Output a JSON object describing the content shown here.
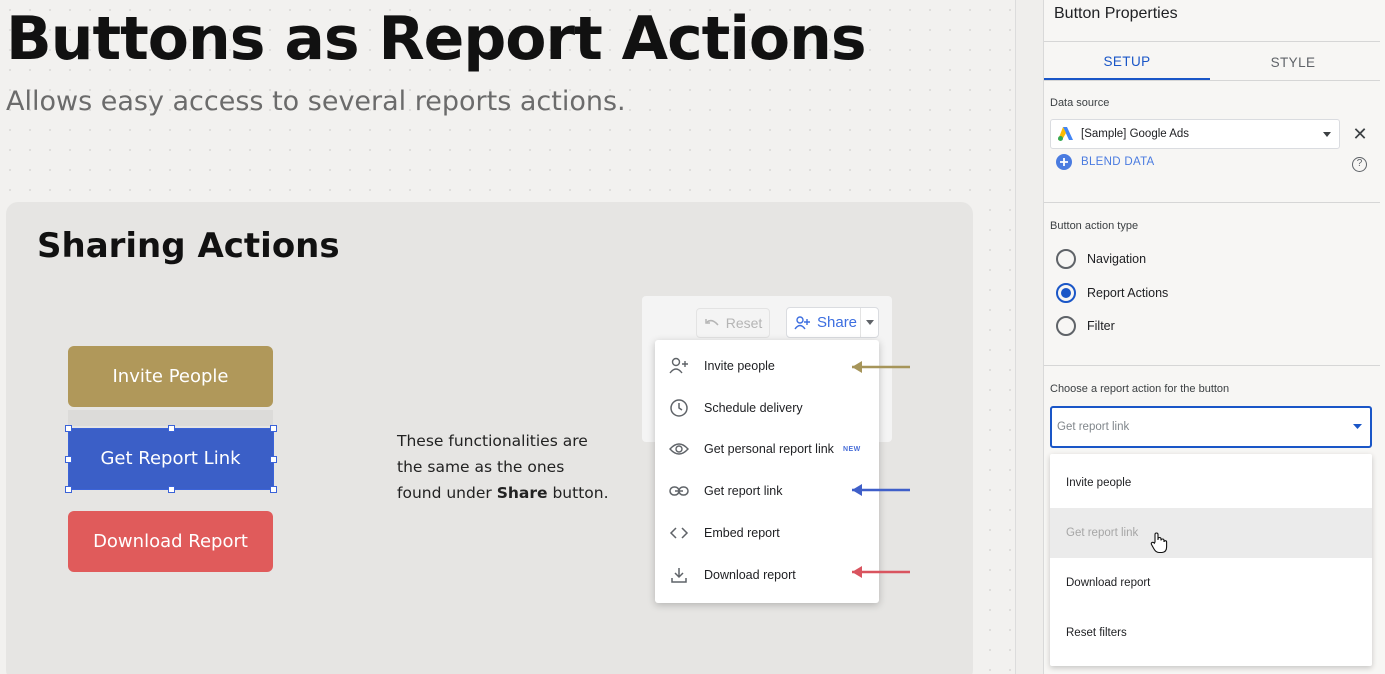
{
  "slide": {
    "title": "Buttons as Report Actions",
    "subtitle": "Allows easy access to several reports actions.",
    "card_title": "Sharing Actions",
    "buttons": {
      "invite": "Invite People",
      "get_link": "Get Report Link",
      "download": "Download Report"
    },
    "button_colors": {
      "invite": "#b0985a",
      "get_link": "#3b5fc7",
      "download": "#e05b5b"
    },
    "description": {
      "line1": "These functionalities are",
      "line2": "the same as the ones",
      "line3_prefix": "found under",
      "line3_bold": "Share",
      "line3_suffix": "button."
    }
  },
  "share_toolbar": {
    "reset_label": "Reset",
    "share_label": "Share",
    "menu_items": [
      {
        "label": "Invite people",
        "icon": "person-add-icon"
      },
      {
        "label": "Schedule delivery",
        "icon": "clock-icon"
      },
      {
        "label": "Get personal report link",
        "icon": "eye-icon",
        "badge": "NEW"
      },
      {
        "label": "Get report link",
        "icon": "link-icon"
      },
      {
        "label": "Embed report",
        "icon": "code-icon"
      },
      {
        "label": "Download report",
        "icon": "download-icon"
      }
    ],
    "arrow_colors": {
      "invite": "#a6955a",
      "get_link": "#3f5fc9",
      "download": "#d9545f"
    }
  },
  "panel": {
    "title": "Button Properties",
    "tabs": {
      "setup": "SETUP",
      "style": "STYLE"
    },
    "data_source_label": "Data source",
    "data_source_value": "[Sample] Google Ads",
    "blend_label": "BLEND DATA",
    "help_glyph": "?",
    "action_type_label": "Button action type",
    "action_types": [
      "Navigation",
      "Report Actions",
      "Filter"
    ],
    "action_type_selected": "Report Actions",
    "choose_label": "Choose a report action for the button",
    "choose_value": "Get report link",
    "options": [
      "Invite people",
      "Get report link",
      "Download report",
      "Reset filters"
    ],
    "hovered_option": "Get report link",
    "accent_color": "#1a56c7"
  }
}
